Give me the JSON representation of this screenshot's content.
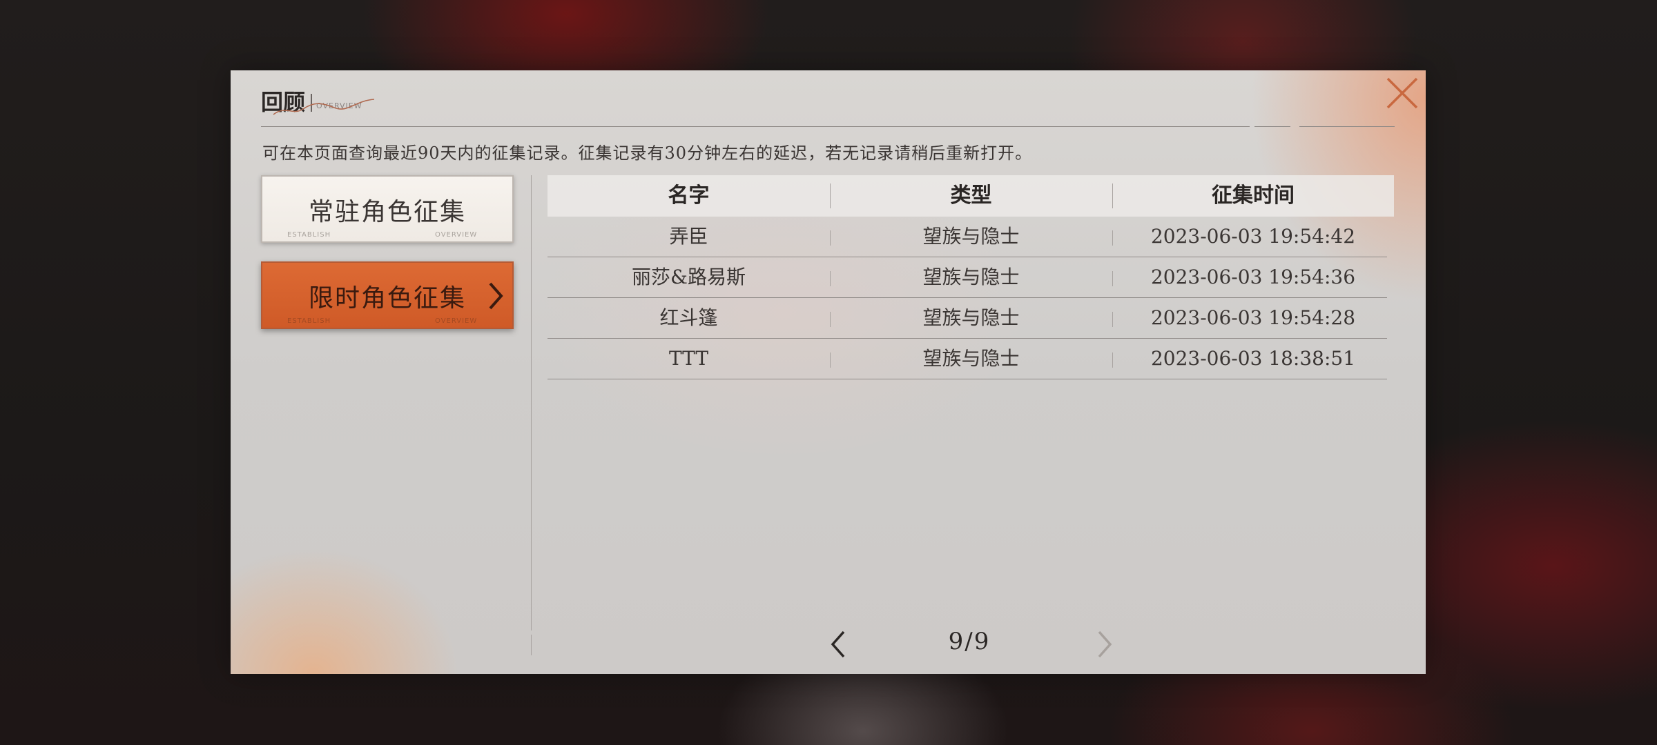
{
  "header": {
    "title": "回顾",
    "subtitle": "OVERVIEW"
  },
  "notice": "可在本页面查询最近90天内的征集记录。征集记录有30分钟左右的延迟，若无记录请稍后重新打开。",
  "categories": [
    {
      "label": "常驻角色征集",
      "selected": false,
      "mini_left": "ESTABLISH",
      "mini_right": "OVERVIEW"
    },
    {
      "label": "限时角色征集",
      "selected": true,
      "mini_left": "ESTABLISH",
      "mini_right": "OVERVIEW"
    }
  ],
  "table": {
    "headers": [
      "名字",
      "类型",
      "征集时间"
    ],
    "rows": [
      [
        "弄臣",
        "望族与隐士",
        "2023-06-03 19:54:42"
      ],
      [
        "丽莎&路易斯",
        "望族与隐士",
        "2023-06-03 19:54:36"
      ],
      [
        "红斗篷",
        "望族与隐士",
        "2023-06-03 19:54:28"
      ],
      [
        "TTT",
        "望族与隐士",
        "2023-06-03 18:38:51"
      ]
    ]
  },
  "pagination": {
    "text": "9/9",
    "current": 9,
    "total": 9
  },
  "colors": {
    "accent": "#d4602c",
    "close": "#c9683f"
  }
}
